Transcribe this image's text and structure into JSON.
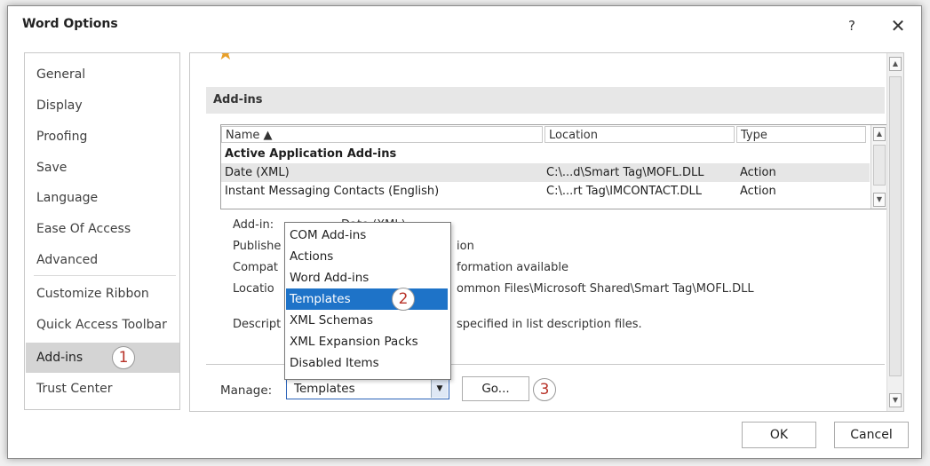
{
  "window": {
    "title": "Word Options",
    "help_label": "?",
    "close_label": "✕"
  },
  "sidebar": {
    "items": [
      {
        "label": "General"
      },
      {
        "label": "Display"
      },
      {
        "label": "Proofing"
      },
      {
        "label": "Save"
      },
      {
        "label": "Language"
      },
      {
        "label": "Ease Of Access"
      },
      {
        "label": "Advanced"
      },
      {
        "label": "Customize Ribbon"
      },
      {
        "label": "Quick Access Toolbar"
      },
      {
        "label": "Add-ins"
      },
      {
        "label": "Trust Center"
      }
    ],
    "selected": "Add-ins"
  },
  "badges": [
    "1",
    "2",
    "3"
  ],
  "addins": {
    "section_title": "Add-ins",
    "columns": [
      "Name ▲",
      "Location",
      "Type"
    ],
    "rows": [
      {
        "name": "Active Application Add-ins",
        "location": "",
        "type": ""
      },
      {
        "name": "Date (XML)",
        "location": "C:\\...d\\Smart Tag\\MOFL.DLL",
        "type": "Action"
      },
      {
        "name": "Instant Messaging Contacts (English)",
        "location": "C:\\...rt Tag\\IMCONTACT.DLL",
        "type": "Action"
      }
    ]
  },
  "details": {
    "addin_label": "Add-in:",
    "addin_value": "Date (XML)",
    "publisher_label": "Publishe",
    "publisher_value": "ion",
    "compat_label": "Compat",
    "compat_value": "formation available",
    "location_label": "Locatio",
    "location_value": "ommon Files\\Microsoft Shared\\Smart Tag\\MOFL.DLL",
    "description_label": "Descript",
    "description_value": "specified in list description files."
  },
  "manage_dropdown": {
    "options": [
      "COM Add-ins",
      "Actions",
      "Word Add-ins",
      "Templates",
      "XML Schemas",
      "XML Expansion Packs",
      "Disabled Items"
    ],
    "highlighted": "Templates"
  },
  "manage": {
    "label": "Manage:",
    "value": "Templates",
    "go_label": "Go..."
  },
  "footer": {
    "ok_label": "OK",
    "cancel_label": "Cancel"
  },
  "colors": {
    "selection_blue": "#1e73c8",
    "badge_red": "#b83228"
  }
}
